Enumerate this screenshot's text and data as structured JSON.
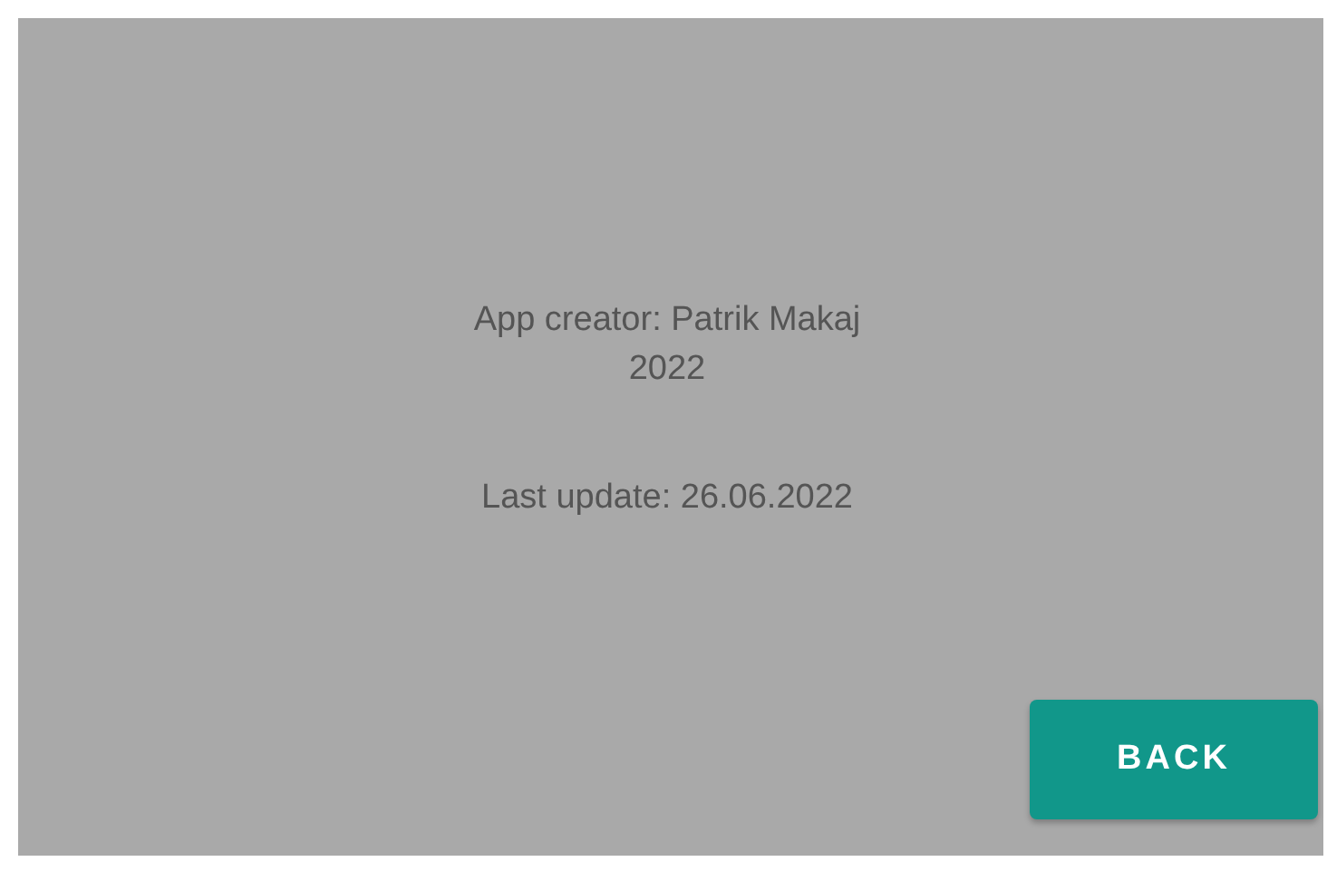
{
  "about": {
    "lines": [
      "App creator: Patrik Makaj",
      "2022"
    ],
    "last_update": "Last update: 26.06.2022"
  },
  "buttons": [
    {
      "label": "BACK"
    }
  ]
}
